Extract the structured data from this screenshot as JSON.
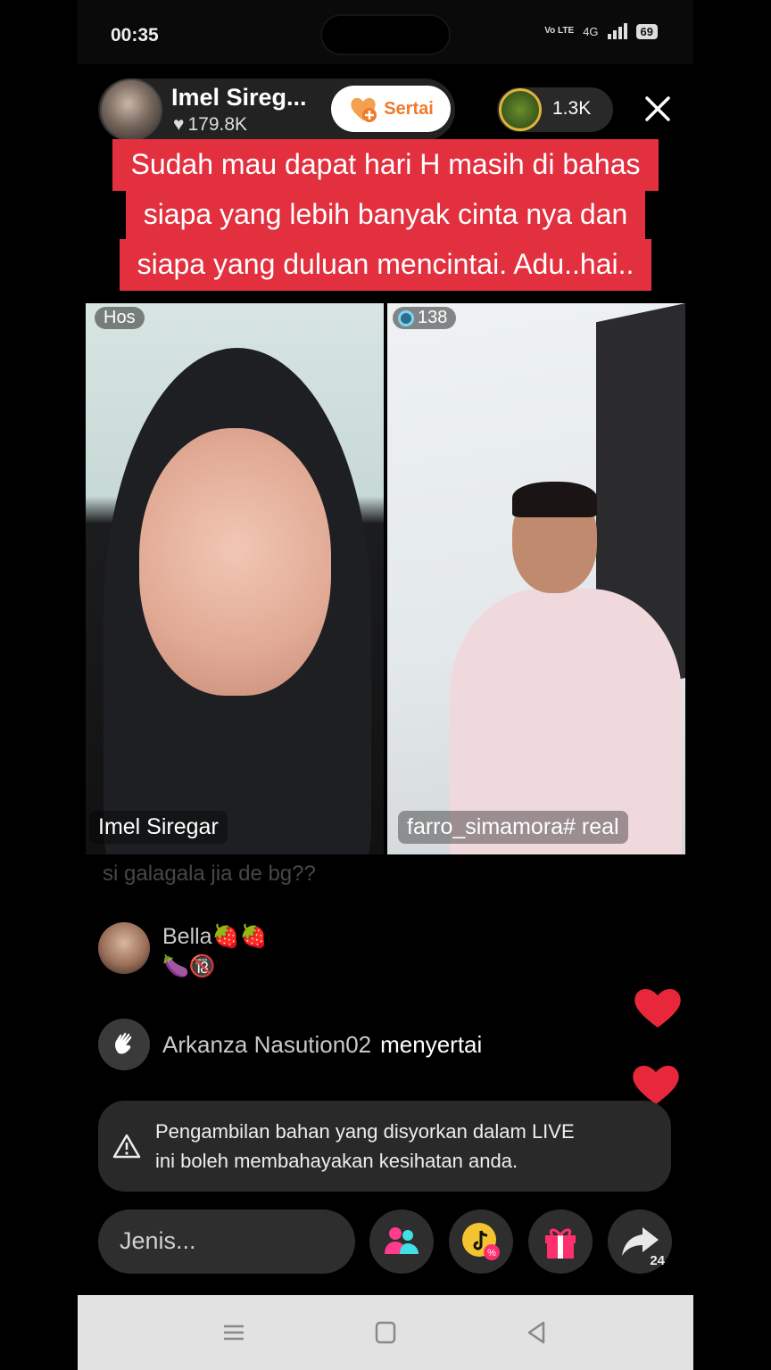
{
  "status_bar": {
    "time": "00:35",
    "network_label": "4G",
    "volte": "Vo LTE",
    "battery": "69"
  },
  "host": {
    "name": "Imel Sireg...",
    "likes": "179.8K",
    "follow_label": "Sertai"
  },
  "viewers": {
    "count": "1.3K"
  },
  "caption": [
    "Sudah mau dapat hari H  masih di bahas",
    "siapa yang lebih banyak cinta nya dan",
    "siapa yang duluan mencintai. Adu..hai.."
  ],
  "panels": {
    "left": {
      "tag": "Hos",
      "name": "Imel Siregar"
    },
    "right": {
      "coins": "138",
      "name": "farro_simamora# real"
    }
  },
  "comments": {
    "faded": "si galagala jia de bg??",
    "bella": {
      "user": "Bella🍓🍓",
      "text": "🍆🔞"
    },
    "join": {
      "user": "Arkanza Nasution02",
      "verb": "menyertai"
    }
  },
  "warning": {
    "line1": "Pengambilan bahan yang disyorkan dalam LIVE",
    "line2": "ini boleh membahayakan kesihatan anda."
  },
  "bottom": {
    "input_placeholder": "Jenis...",
    "share_count": "24"
  },
  "colors": {
    "caption_bg": "#e2303f",
    "heart": "#e8283a",
    "follow_text": "#f07a2a"
  }
}
